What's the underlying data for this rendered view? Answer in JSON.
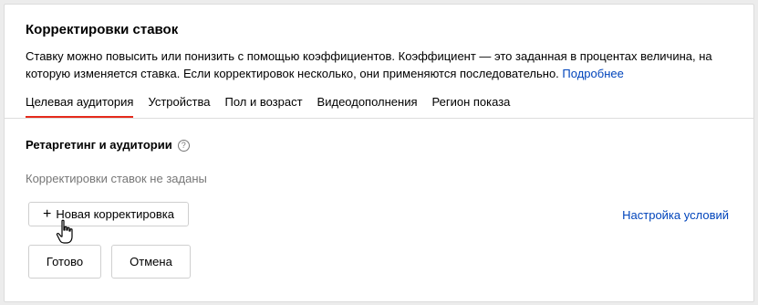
{
  "panel": {
    "title": "Корректировки ставок",
    "description": "Ставку можно повысить или понизить с помощью коэффициентов. Коэффициент — это заданная в процентах величина, на которую изменяется ставка. Если корректировок несколько, они применяются последовательно.",
    "more_link": "Подробнее"
  },
  "tabs": [
    {
      "label": "Целевая аудитория",
      "active": true
    },
    {
      "label": "Устройства",
      "active": false
    },
    {
      "label": "Пол и возраст",
      "active": false
    },
    {
      "label": "Видеодополнения",
      "active": false
    },
    {
      "label": "Регион показа",
      "active": false
    }
  ],
  "section": {
    "title": "Ретаргетинг и аудитории",
    "help_icon": "question-circle-icon",
    "empty_text": "Корректировки ставок не заданы"
  },
  "actions": {
    "new_button_icon": "+",
    "new_button_label": "Новая корректировка",
    "settings_link": "Настройка условий",
    "done_label": "Готово",
    "cancel_label": "Отмена"
  },
  "colors": {
    "accent_tab_underline": "#e52b1c",
    "link": "#0044bb"
  }
}
